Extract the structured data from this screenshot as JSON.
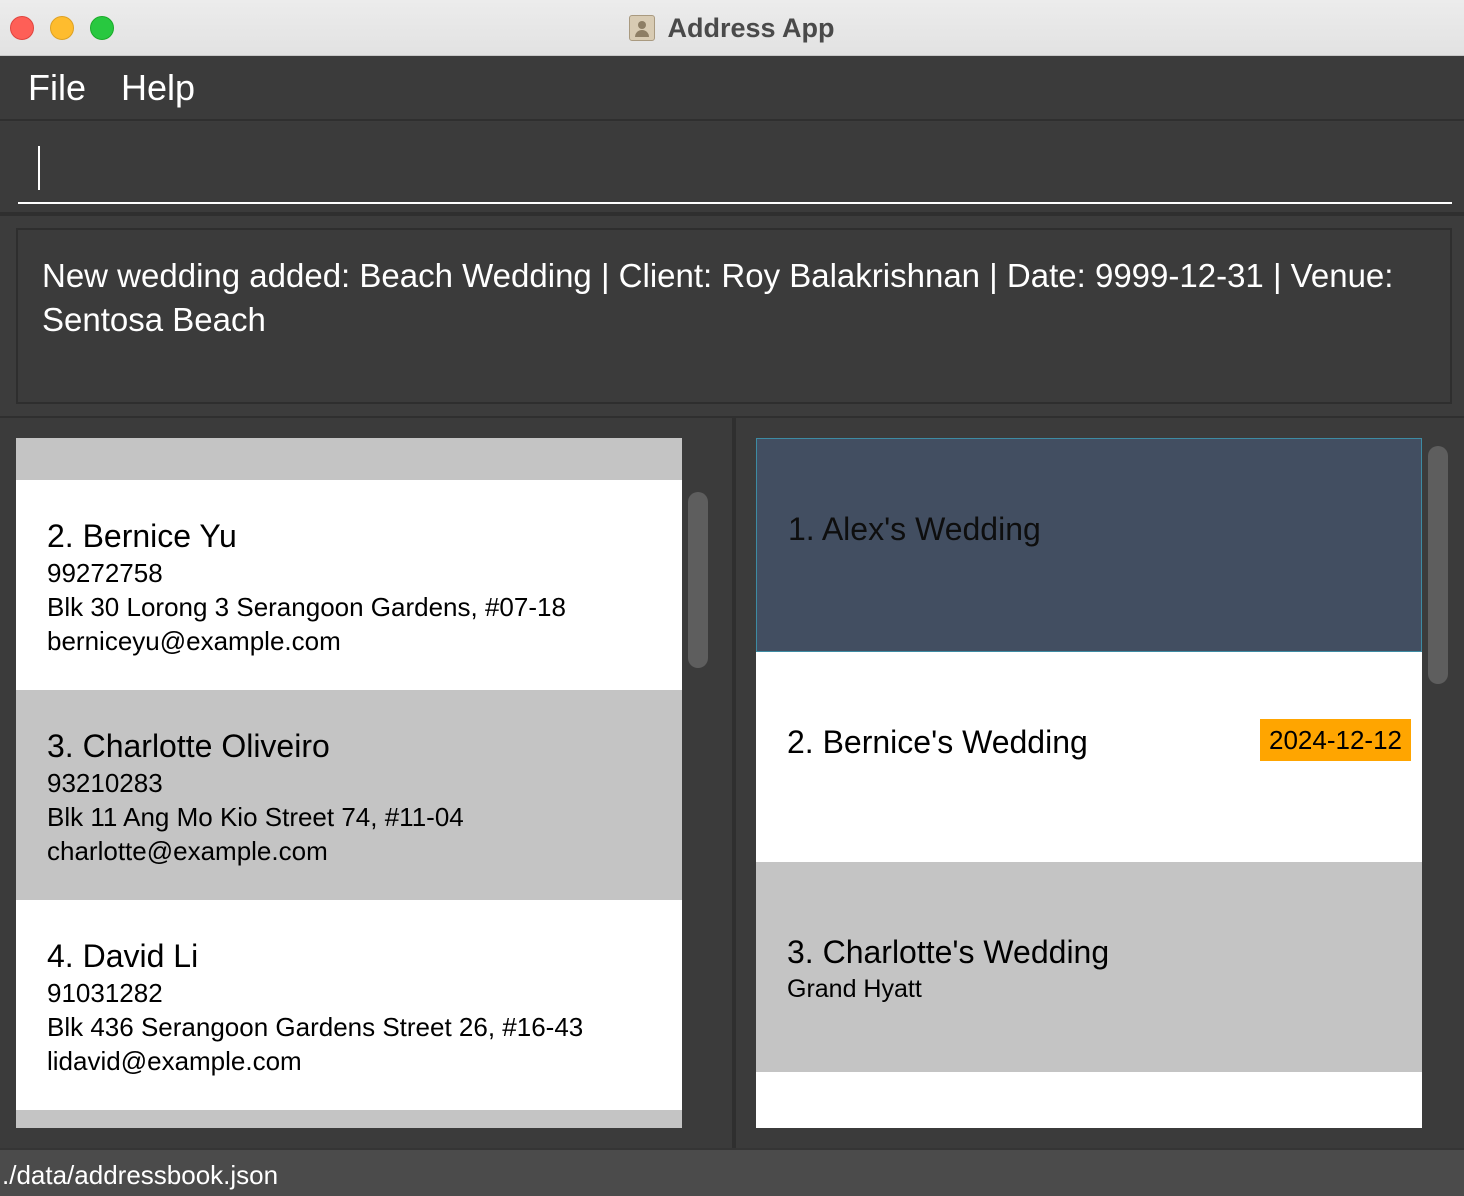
{
  "window": {
    "title": "Address App"
  },
  "menu": {
    "file": "File",
    "help": "Help"
  },
  "command": {
    "value": ""
  },
  "result": {
    "message": "New wedding added: Beach Wedding | Client: Roy Balakrishnan | Date: 9999-12-31 | Venue: Sentosa Beach"
  },
  "persons": [
    {
      "name": "2. Bernice Yu",
      "phone": "99272758",
      "address": "Blk 30 Lorong 3 Serangoon Gardens, #07-18",
      "email": "berniceyu@example.com"
    },
    {
      "name": "3. Charlotte Oliveiro",
      "phone": "93210283",
      "address": "Blk 11 Ang Mo Kio Street 74, #11-04",
      "email": "charlotte@example.com"
    },
    {
      "name": "4. David Li",
      "phone": "91031282",
      "address": "Blk 436 Serangoon Gardens Street 26, #16-43",
      "email": "lidavid@example.com"
    }
  ],
  "weddings": [
    {
      "name": "1. Alex's Wedding",
      "selected": true
    },
    {
      "name": "2. Bernice's Wedding",
      "date": "2024-12-12"
    },
    {
      "name": "3. Charlotte's Wedding",
      "venue": "Grand Hyatt"
    }
  ],
  "status": {
    "path": "./data/addressbook.json"
  },
  "colors": {
    "selected_card": "#424e61",
    "date_badge": "#ffa500",
    "background": "#3b3b3b"
  }
}
